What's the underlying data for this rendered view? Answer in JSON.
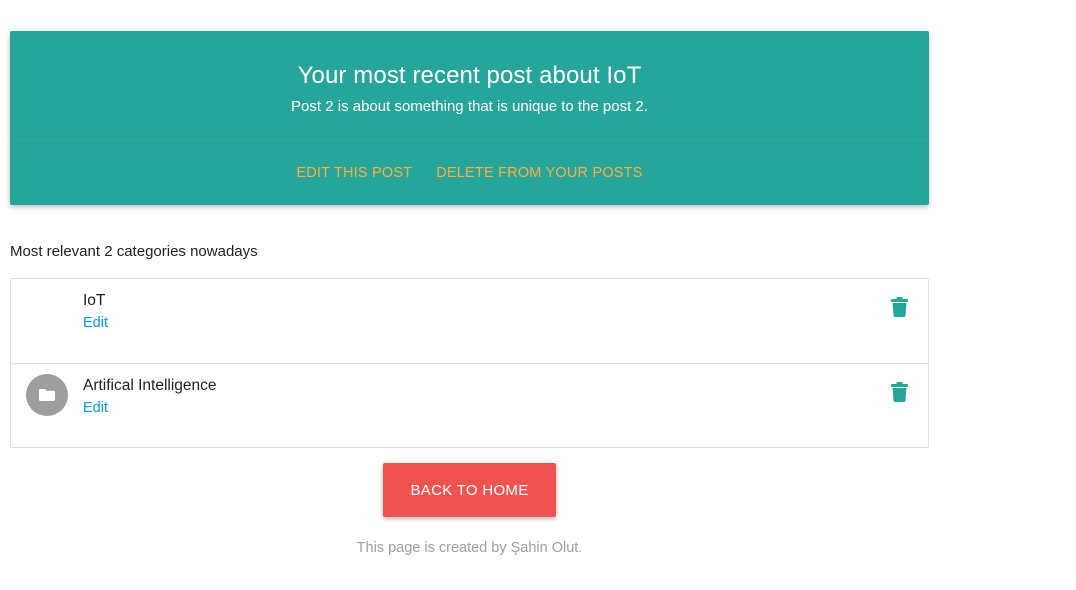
{
  "card": {
    "title": "Your most recent post about IoT",
    "text": "Post 2 is about something that is unique to the post 2.",
    "actions": {
      "edit": "EDIT THIS POST",
      "delete": "DELETE FROM YOUR POSTS"
    }
  },
  "section": {
    "heading": "Most relevant 2 categories nowadays"
  },
  "categories": [
    {
      "title": "IoT",
      "edit": "Edit",
      "icon": "none"
    },
    {
      "title": "Artifical Intelligence",
      "edit": "Edit",
      "icon": "folder-icon"
    }
  ],
  "back_button": {
    "label": "BACK TO HOME"
  },
  "footer": {
    "text": "This page is created by Şahin Olut."
  },
  "colors": {
    "card_bg": "#26a69a",
    "action_text": "#ffab40",
    "link": "#039be5",
    "trash_icon": "#26a69a",
    "button_bg": "#ef5350",
    "avatar_bg": "#9e9e9e"
  }
}
